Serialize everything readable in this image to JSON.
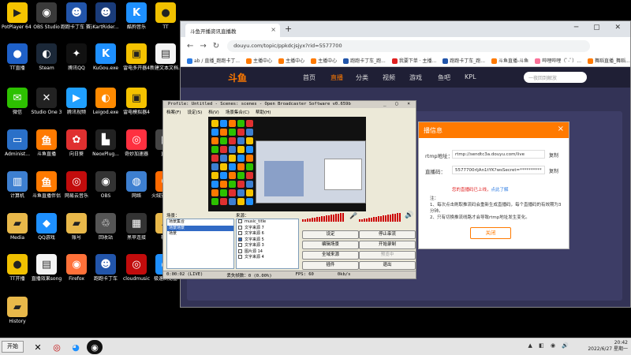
{
  "desktop": {
    "icons": [
      {
        "label": "PotPlayer 64 bit",
        "glyph": "▶",
        "bg": "#f6c400",
        "fg": "#222"
      },
      {
        "label": "OBS Studio",
        "glyph": "◉",
        "bg": "#3a3a3a",
        "fg": "#fff"
      },
      {
        "label": "跑跑卡丁车 赛道",
        "glyph": "☻",
        "bg": "#2255aa",
        "fg": "#fff"
      },
      {
        "label": "KartRider...",
        "glyph": "☻",
        "bg": "#1a3c7a",
        "fg": "#fff"
      },
      {
        "label": "酷狗音乐",
        "glyph": "K",
        "bg": "#1e90ff",
        "fg": "#fff"
      },
      {
        "label": "TT",
        "glyph": "●",
        "bg": "#f0c000",
        "fg": "#222"
      },
      {
        "label": "TT直播",
        "glyph": "●",
        "bg": "#1e60c8",
        "fg": "#fff"
      },
      {
        "label": "Steam",
        "glyph": "◐",
        "bg": "#1b2838",
        "fg": "#fff"
      },
      {
        "label": "腾讯QQ",
        "glyph": "✦",
        "bg": "#111",
        "fg": "#fff"
      },
      {
        "label": "KuGou.exe",
        "glyph": "K",
        "bg": "#1e90ff",
        "fg": "#fff"
      },
      {
        "label": "雷电多开器4",
        "glyph": "▣",
        "bg": "#f5c200",
        "fg": "#222"
      },
      {
        "label": "新建文本文档.txt",
        "glyph": "▤",
        "bg": "#f4f4f4",
        "fg": "#333"
      },
      {
        "label": "微信",
        "glyph": "✉",
        "bg": "#2dc100",
        "fg": "#fff"
      },
      {
        "label": "Studio One 3",
        "glyph": "✕",
        "bg": "#222",
        "fg": "#fff"
      },
      {
        "label": "腾讯视频",
        "glyph": "▶",
        "bg": "#20a0ff",
        "fg": "#fff"
      },
      {
        "label": "Leigod.exe",
        "glyph": "◐",
        "bg": "#ff8a00",
        "fg": "#fff"
      },
      {
        "label": "雷电模拟器4",
        "glyph": "▣",
        "bg": "#f5c200",
        "fg": "#222"
      },
      {
        "label": "",
        "glyph": "",
        "bg": "transparent",
        "fg": "#fff"
      },
      {
        "label": "Administ...",
        "glyph": "▭",
        "bg": "#2a70c8",
        "fg": "#fff"
      },
      {
        "label": "斗鱼直播",
        "glyph": "鱼",
        "bg": "#ff7a00",
        "fg": "#fff"
      },
      {
        "label": "向日葵",
        "glyph": "✿",
        "bg": "#e03030",
        "fg": "#fff"
      },
      {
        "label": "NeoxPlug...",
        "glyph": "▙",
        "bg": "#222",
        "fg": "#fff"
      },
      {
        "label": "奇妙加速器",
        "glyph": "◎",
        "bg": "#ff3040",
        "fg": "#fff"
      },
      {
        "label": "直播",
        "glyph": "▦",
        "bg": "#444",
        "fg": "#fff"
      },
      {
        "label": "计算机",
        "glyph": "▥",
        "bg": "#3d7fd0",
        "fg": "#fff"
      },
      {
        "label": "斗鱼直播伴侣",
        "glyph": "鱼",
        "bg": "#ff7a00",
        "fg": "#fff"
      },
      {
        "label": "网易云音乐",
        "glyph": "◎",
        "bg": "#c20c0c",
        "fg": "#fff"
      },
      {
        "label": "OBS",
        "glyph": "◉",
        "bg": "#333",
        "fg": "#fff"
      },
      {
        "label": "网络",
        "glyph": "◍",
        "bg": "#3d7fd0",
        "fg": "#fff"
      },
      {
        "label": "火绒安全软件",
        "glyph": "✪",
        "bg": "#ff6a00",
        "fg": "#fff"
      },
      {
        "label": "Media",
        "glyph": "▰",
        "bg": "#e8b84a",
        "fg": "#222"
      },
      {
        "label": "QQ游戏",
        "glyph": "◆",
        "bg": "#1e90ff",
        "fg": "#fff"
      },
      {
        "label": "账号",
        "glyph": "▰",
        "bg": "#e8b84a",
        "fg": "#222"
      },
      {
        "label": "回收站",
        "glyph": "♲",
        "bg": "#555",
        "fg": "#fff"
      },
      {
        "label": "黑苹连接",
        "glyph": "▦",
        "bg": "#333",
        "fg": "#fff"
      },
      {
        "label": "软件",
        "glyph": "▰",
        "bg": "#e8b84a",
        "fg": "#222"
      },
      {
        "label": "TT开播",
        "glyph": "●",
        "bg": "#f0c000",
        "fg": "#222"
      },
      {
        "label": "直播效果song",
        "glyph": "▤",
        "bg": "#f4f4f4",
        "fg": "#333"
      },
      {
        "label": "Firefox",
        "glyph": "◉",
        "bg": "#ff7139",
        "fg": "#fff"
      },
      {
        "label": "跑跑卡丁车",
        "glyph": "☻",
        "bg": "#2255aa",
        "fg": "#fff"
      },
      {
        "label": "cloudmusic",
        "glyph": "◎",
        "bg": "#c20c0c",
        "fg": "#fff"
      },
      {
        "label": "极速浏览器",
        "glyph": "◕",
        "bg": "#1e90ff",
        "fg": "#fff"
      },
      {
        "label": "History",
        "glyph": "▰",
        "bg": "#e8b84a",
        "fg": "#222"
      }
    ]
  },
  "browser": {
    "tab_title": "斗鱼开播资讯直播教",
    "url": "douyu.com/topic/ppkdcjsjyx?rid=5577700",
    "bookmarks": [
      "ab / 直播_跑跑卡丁...",
      "主播中心",
      "主播中心",
      "主播中心",
      "跑跑卡丁车_跑...",
      "我要下单 · 主播...",
      "跑跑卡丁车_跑...",
      "斗鱼直播-斗鱼",
      "哔哩哔哩（ﾟ-ﾟ）...",
      "舞蹈直播_舞蹈..."
    ],
    "site": {
      "logo": "斗鱼",
      "nav": [
        "首页",
        "直播",
        "分类",
        "视频",
        "游戏",
        "鱼吧",
        "KPL"
      ],
      "search_placeholder": "一夜回到解放"
    }
  },
  "dialog": {
    "title": "播信息",
    "rtmp_label": "rtmp地址：",
    "rtmp_value": "rtmp://sendtc3a.douyu.com/live",
    "copy": "复制",
    "key_label": "直播码：",
    "key_value": "5577700rljAn1tYK?wsSecret=**********",
    "warn": "您的直播码已上线，",
    "warn_link": "点此了解",
    "notes_title": "注：",
    "notes": [
      "1、每次点击刷取推流码会重新生成直播码，每个直播码的有效期为3分钟。",
      "2、只有切换推流线路才会导致rtmp地址发生变化。"
    ],
    "close_button": "关闭",
    "accent": "#ff7a00"
  },
  "obs": {
    "title": "Profile: Untitled - Scenes: scenes - Open Broadcaster Software v0.659b",
    "menu": [
      "档案(F)",
      "设定(S)",
      "档(V)",
      "场景集合(C)",
      "帮助(H)"
    ],
    "scenes_label": "场景：",
    "sources_label": "来源：",
    "scenes": [
      "场景集合",
      "场景场景",
      "场景"
    ],
    "sources": [
      {
        "name": "music_title",
        "checked": false
      },
      {
        "name": "文字来源 7",
        "checked": false
      },
      {
        "name": "文字来源 6",
        "checked": false
      },
      {
        "name": "文字来源 5",
        "checked": true
      },
      {
        "name": "文字来源 3",
        "checked": false
      },
      {
        "name": "图片源 14",
        "checked": false
      },
      {
        "name": "文字来源 4",
        "checked": false
      }
    ],
    "buttons": {
      "settings": "设定",
      "stop_stream": "停止串流",
      "edit_scene": "编辑场景",
      "start_record": "开始录制",
      "global_sources": "全域来源",
      "preview": "预览中",
      "plugins": "插件",
      "exit": "退出"
    },
    "status": {
      "time": "0:00:02 (LIVE)",
      "dropped": "丢失帧数：0 (0.00%)",
      "fps": "FPS: 60",
      "bitrate": "0kb/s"
    }
  },
  "taskbar": {
    "start": "开始",
    "time": "20:42",
    "date": "2022/6/27 星期一"
  }
}
